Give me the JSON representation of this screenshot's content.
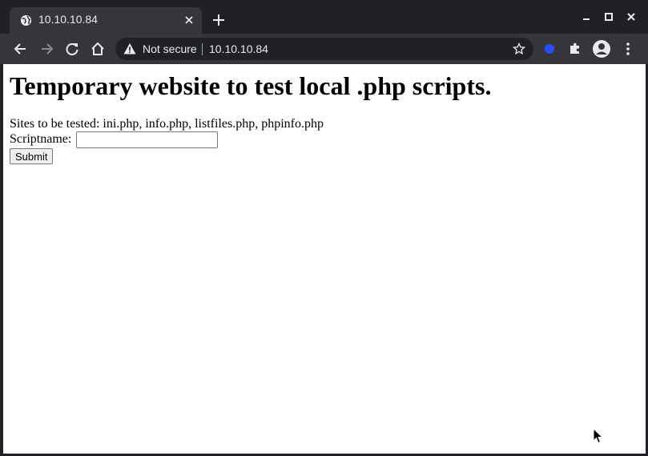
{
  "tab": {
    "title": "10.10.10.84",
    "favicon": "globe-icon"
  },
  "omnibox": {
    "security_label": "Not secure",
    "url": "10.10.10.84"
  },
  "page": {
    "heading": "Temporary website to test local .php scripts.",
    "sites_text": "Sites to be tested: ini.php, info.php, listfiles.php, phpinfo.php",
    "script_label": "Scriptname:",
    "script_value": "",
    "submit_label": "Submit"
  },
  "colors": {
    "chrome_dark": "#202124",
    "toolbar": "#35363a",
    "text_light": "#e8eaed",
    "ext_blue": "#2b4bff"
  }
}
